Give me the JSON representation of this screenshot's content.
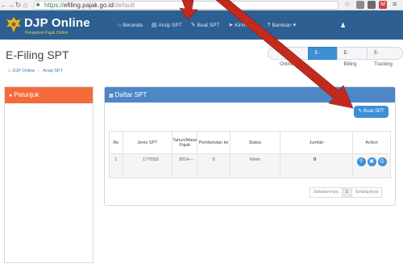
{
  "browser": {
    "url_scheme": "https://",
    "url_host": "efiling.pajak.go.id",
    "url_path": "/default"
  },
  "header": {
    "brand": "DJP Online",
    "tagline": "Pelayanan Pajak Online",
    "nav": [
      {
        "label": "Beranda",
        "icon": "home-icon"
      },
      {
        "label": "Arsip SPT",
        "icon": "folder-icon"
      },
      {
        "label": "Buat SPT",
        "icon": "edit-icon"
      },
      {
        "label": "Kirim SPT",
        "icon": "send-icon"
      },
      {
        "label": "Bantuan",
        "icon": "help-icon"
      }
    ]
  },
  "page": {
    "title": "E-Filing SPT",
    "tabs": [
      "Profil Online",
      "E-Filing",
      "E-Billing",
      "E-Tracking"
    ],
    "active_tab": "E-Filing",
    "breadcrumb": [
      "DJP Online",
      "Arsip SPT"
    ]
  },
  "left_panel": {
    "title": "Petunjuk"
  },
  "main_panel": {
    "title": "Daftar SPT",
    "create_button": "Buat SPT",
    "columns": [
      "No",
      "Jenis SPT",
      "Tahun/Masa Pajak",
      "Pembetulan ke",
      "Status",
      "Jumlah",
      "Action"
    ],
    "rows": [
      {
        "no": "1",
        "jenis": "1770SS",
        "tahun": "2014---",
        "pembetulan": "0",
        "status": "Kirim",
        "jumlah": "0"
      }
    ],
    "pager": {
      "prev": "Sebelumnya",
      "page": "1",
      "next": "Selanjutnya"
    }
  },
  "colors": {
    "header_bg": "#2d5f92",
    "accent": "#3a8fd8",
    "left_head": "#f36b3a",
    "panel_head": "#4f86c6",
    "arrow": "#c22a1f"
  }
}
